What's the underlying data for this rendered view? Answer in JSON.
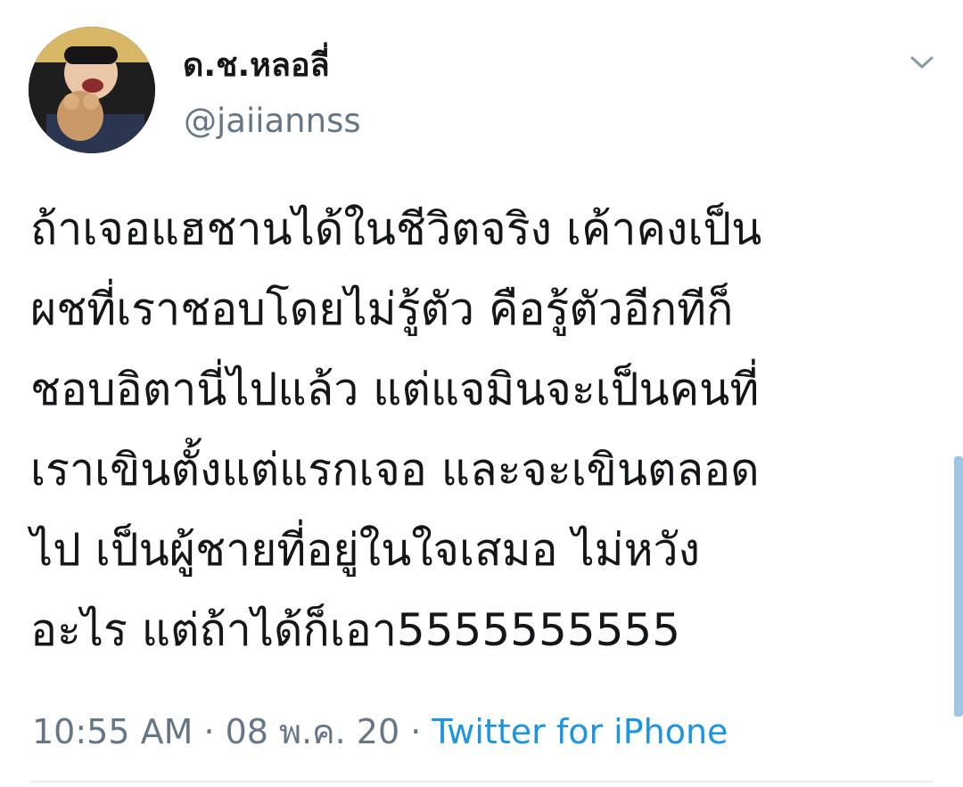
{
  "tweet": {
    "author": {
      "display_name": "ด.ช.หลอลี่",
      "handle": "@jaiiannss"
    },
    "body_lines": [
      "ถ้าเจอแฮชานได้ในชีวิตจริง เค้าคงเป็น",
      "ผชที่เราชอบโดยไม่รู้ตัว คือรู้ตัวอีกทีก็",
      "ชอบอิตานี่ไปแล้ว แต่แจมินจะเป็นคนที่",
      "เราเขินตั้งแต่แรกเจอ และจะเขินตลอด",
      "ไป เป็นผู้ชายที่อยู่ในใจเสมอ ไม่หวัง",
      "อะไร แต่ถ้าได้ก็เอา5555555555"
    ],
    "time": "10:55 AM",
    "separator": " · ",
    "date": "08 พ.ค. 20",
    "source": "Twitter for iPhone"
  },
  "icons": {
    "avatar": "profile-photo",
    "menu": "chevron-down-icon"
  },
  "colors": {
    "text": "#14171a",
    "secondary": "#657786",
    "link": "#1b95e0"
  }
}
